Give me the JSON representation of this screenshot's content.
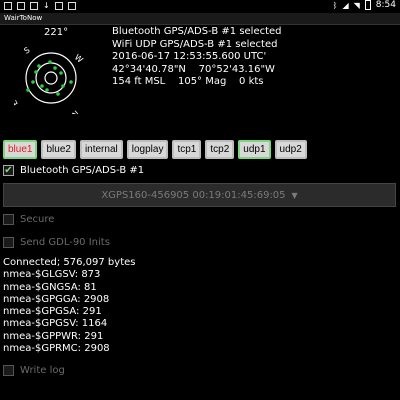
{
  "status_bar": {
    "time": "8:54",
    "left_icons": [
      "status-icon",
      "status-icon",
      "status-icon",
      "download-icon",
      "sd-card-icon",
      "image-icon"
    ],
    "right_icons": [
      "bluetooth-icon",
      "signal-icon",
      "wifi-icon",
      "battery-icon"
    ]
  },
  "app": {
    "title": "WairToNow"
  },
  "compass": {
    "heading": "221°",
    "labels": {
      "north": "N",
      "south": "S",
      "east": "E",
      "west": "W"
    },
    "satellites_in_use_color": "#2ecc40",
    "ring_color": "#ffffff"
  },
  "info": {
    "line1": "Bluetooth GPS/ADS-B #1 selected",
    "line2": "WiFi UDP GPS/ADS-B #1 selected",
    "line3": "2016-06-17 12:53:55.600 UTC'",
    "line4": "42°34'40.78\"N    70°52'43.16\"W",
    "line5": "154 ft MSL    105° Mag    0 kts"
  },
  "tabs": [
    "blue1",
    "blue2",
    "internal",
    "logplay",
    "tcp1",
    "tcp2",
    "udp1",
    "udp2"
  ],
  "selected_tabs": [
    "blue1",
    "udp1"
  ],
  "device": {
    "enabled_label": "Bluetooth GPS/ADS-B #1",
    "enabled_checked": true,
    "dropdown_value": "XGPS160-456905 00:19:01:45:69:05",
    "secure_label": "Secure",
    "send_gdl_label": "Send GDL-90 Inits"
  },
  "log": {
    "connected": "Connected; 576,097 bytes",
    "lines": [
      "nmea-$GLGSV: 873",
      "nmea-$GNGSA: 81",
      "nmea-$GPGGA: 2908",
      "nmea-$GPGSA: 291",
      "nmea-$GPGSV: 1164",
      "nmea-$GPPWR: 291",
      "nmea-$GPRMC: 2908"
    ],
    "write_log_label": "Write log"
  }
}
